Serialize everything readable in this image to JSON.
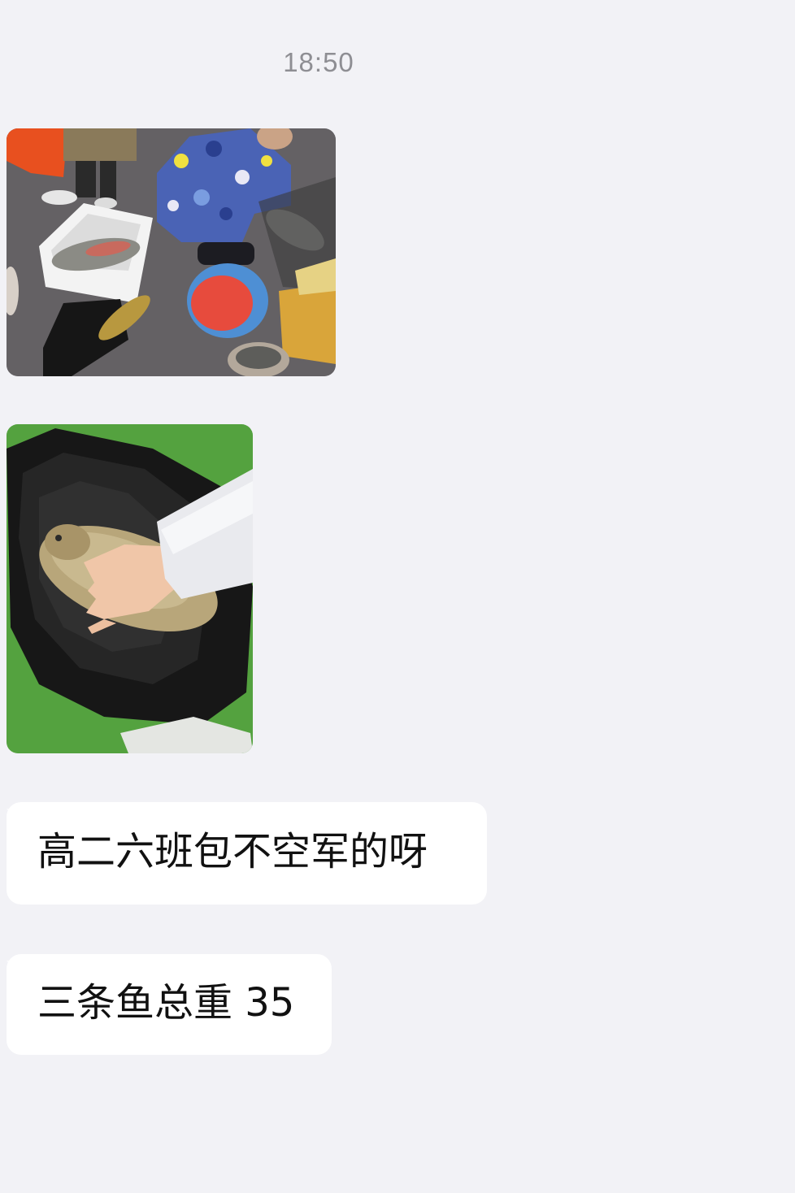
{
  "chat": {
    "timestamp": "18:50",
    "messages": [
      {
        "type": "image",
        "description_icon": "photo-fish-market"
      },
      {
        "type": "image",
        "description_icon": "photo-carp-in-bag"
      },
      {
        "type": "text",
        "text": "高二六班包不空军的呀"
      },
      {
        "type": "text",
        "text": "三条鱼总重 35"
      }
    ]
  },
  "colors": {
    "background": "#f2f2f6",
    "bubble": "#ffffff",
    "timestamp": "#8e8e93",
    "text": "#111111"
  }
}
